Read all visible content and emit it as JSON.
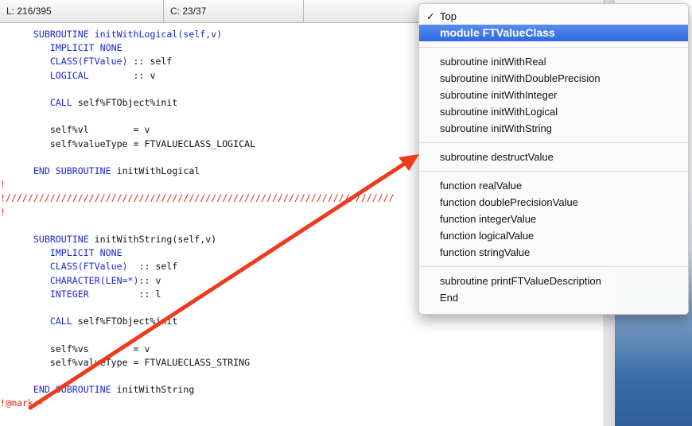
{
  "status": {
    "line": "L: 216/395",
    "column": "C: 23/37"
  },
  "code_lines": [
    {
      "segments": [
        {
          "c": "kw",
          "t": "      SUBROUTINE initWithLogical(self,v)"
        }
      ]
    },
    {
      "segments": [
        {
          "c": "kw",
          "t": "         IMPLICIT NONE"
        }
      ]
    },
    {
      "segments": [
        {
          "c": "kw",
          "t": "         CLASS(FTValue) "
        },
        {
          "c": "tx",
          "t": ":: self"
        }
      ]
    },
    {
      "segments": [
        {
          "c": "kw",
          "t": "         LOGICAL        "
        },
        {
          "c": "tx",
          "t": ":: v"
        }
      ]
    },
    {
      "segments": [
        {
          "c": "tx",
          "t": ""
        }
      ]
    },
    {
      "segments": [
        {
          "c": "kw",
          "t": "         CALL "
        },
        {
          "c": "tx",
          "t": "self%FTObject%init"
        }
      ]
    },
    {
      "segments": [
        {
          "c": "tx",
          "t": ""
        }
      ]
    },
    {
      "segments": [
        {
          "c": "tx",
          "t": "         self%vl        = v"
        }
      ]
    },
    {
      "segments": [
        {
          "c": "tx",
          "t": "         self%valueType = FTVALUECLASS_LOGICAL"
        }
      ]
    },
    {
      "segments": [
        {
          "c": "tx",
          "t": ""
        }
      ]
    },
    {
      "segments": [
        {
          "c": "kw",
          "t": "      END SUBROUTINE "
        },
        {
          "c": "tx",
          "t": "initWithLogical"
        }
      ]
    },
    {
      "segments": [
        {
          "c": "cm",
          "t": "!"
        }
      ]
    },
    {
      "segments": [
        {
          "c": "cm",
          "t": "!//////////////////////////////////////////////////////////////////////"
        }
      ]
    },
    {
      "segments": [
        {
          "c": "cm",
          "t": "!"
        }
      ]
    },
    {
      "segments": [
        {
          "c": "tx",
          "t": ""
        }
      ]
    },
    {
      "segments": [
        {
          "c": "kw",
          "t": "      SUBROUTINE "
        },
        {
          "c": "tx",
          "t": "initWithString(self,v)"
        }
      ]
    },
    {
      "segments": [
        {
          "c": "kw",
          "t": "         IMPLICIT NONE"
        }
      ]
    },
    {
      "segments": [
        {
          "c": "kw",
          "t": "         CLASS(FTValue)  "
        },
        {
          "c": "tx",
          "t": ":: self"
        }
      ]
    },
    {
      "segments": [
        {
          "c": "kw",
          "t": "         CHARACTER(LEN=*)"
        },
        {
          "c": "tx",
          "t": ":: v"
        }
      ]
    },
    {
      "segments": [
        {
          "c": "kw",
          "t": "         INTEGER         "
        },
        {
          "c": "tx",
          "t": ":: l"
        }
      ]
    },
    {
      "segments": [
        {
          "c": "tx",
          "t": ""
        }
      ]
    },
    {
      "segments": [
        {
          "c": "kw",
          "t": "         CALL "
        },
        {
          "c": "tx",
          "t": "self%FTObject%init"
        }
      ]
    },
    {
      "segments": [
        {
          "c": "tx",
          "t": ""
        }
      ]
    },
    {
      "segments": [
        {
          "c": "tx",
          "t": "         self%vs        = v"
        }
      ]
    },
    {
      "segments": [
        {
          "c": "tx",
          "t": "         self%valueType = FTVALUECLASS_STRING"
        }
      ]
    },
    {
      "segments": [
        {
          "c": "tx",
          "t": ""
        }
      ]
    },
    {
      "segments": [
        {
          "c": "kw",
          "t": "      END SUBROUTINE "
        },
        {
          "c": "tx",
          "t": "initWithString"
        }
      ]
    },
    {
      "segments": [
        {
          "c": "cm",
          "t": "!@mark -"
        }
      ]
    }
  ],
  "menu": {
    "checkmark": "✓",
    "items": [
      {
        "label": "Top",
        "checked": true
      },
      {
        "label": "module FTValueClass",
        "selected": true
      },
      {
        "sep": true
      },
      {
        "label": "subroutine initWithReal"
      },
      {
        "label": "subroutine initWithDoublePrecision"
      },
      {
        "label": "subroutine initWithInteger"
      },
      {
        "label": "subroutine initWithLogical"
      },
      {
        "label": "subroutine initWithString"
      },
      {
        "sep": true
      },
      {
        "label": "subroutine destructValue"
      },
      {
        "sep": true
      },
      {
        "label": "function realValue"
      },
      {
        "label": "function doublePrecisionValue"
      },
      {
        "label": "function integerValue"
      },
      {
        "label": "function logicalValue"
      },
      {
        "label": "function stringValue"
      },
      {
        "sep": true
      },
      {
        "label": "subroutine printFTValueDescription"
      },
      {
        "label": "End"
      }
    ]
  },
  "colors": {
    "keyword": "#1b26d6",
    "comment": "#e8261b",
    "arrow": "#ee3a1d",
    "selection": "#2f68e0"
  }
}
